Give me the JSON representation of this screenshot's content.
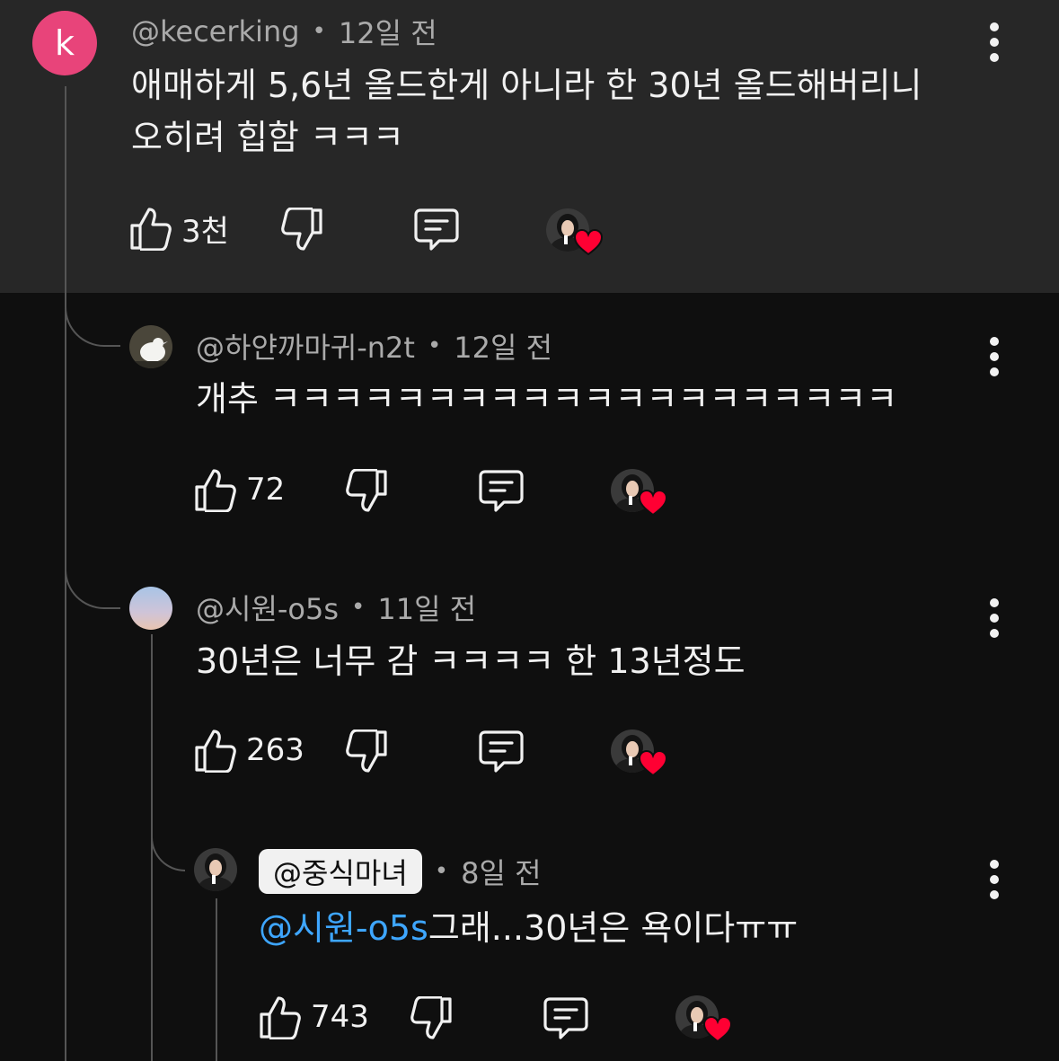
{
  "colors": {
    "highlight_bg": "#272727",
    "bg": "#0f0f0f",
    "mention": "#3ea6ff",
    "avatar_k": "#e8447a",
    "heart": "#ff0033"
  },
  "comments": [
    {
      "handle": "@kecerking",
      "time": "12일 전",
      "line1": "애매하게 5,6년 올드한게 아니라 한 30년 올드해버리니",
      "line2": "오히려 힙함 ㅋㅋㅋ",
      "likes": "3천",
      "avatar_letter": "k"
    },
    {
      "handle": "@하얀까마귀-n2t",
      "time": "12일 전",
      "text": "개추 ㅋㅋㅋㅋㅋㅋㅋㅋㅋㅋㅋㅋㅋㅋㅋㅋㅋㅋㅋㅋ",
      "likes": "72"
    },
    {
      "handle": "@시원-o5s",
      "time": "11일 전",
      "text": "30년은 너무 감 ㅋㅋㅋㅋ 한 13년정도",
      "likes": "263"
    },
    {
      "handle": "@중식마녀",
      "time": "8일 전",
      "mention": "@시원-o5s",
      "text": "그래...30년은 욕이다ㅠㅠ",
      "likes": "743"
    }
  ],
  "icons": {
    "like": "thumb-up-icon",
    "dislike": "thumb-down-icon",
    "reply": "comment-icon",
    "more": "more-vert-icon",
    "heart": "creator-heart-icon"
  }
}
